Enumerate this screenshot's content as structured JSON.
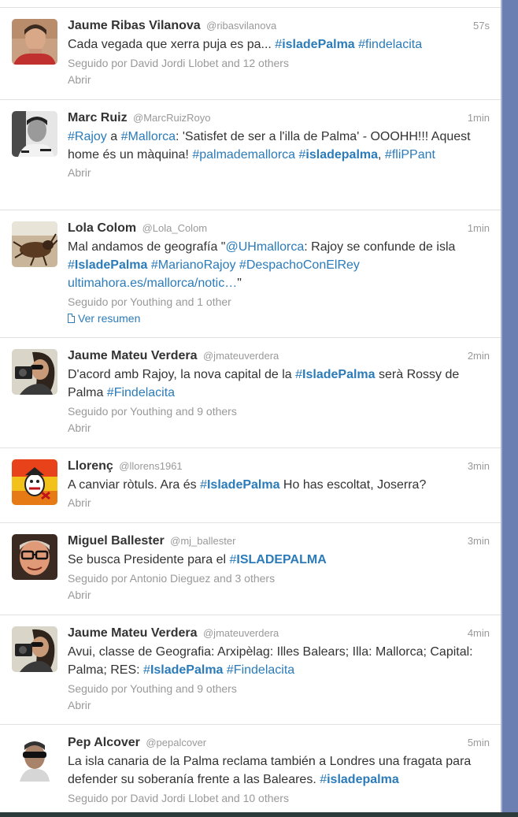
{
  "colors": {
    "link": "#2b7bb9",
    "muted": "#999999",
    "text": "#333333",
    "edge": "#6b7fb3"
  },
  "tweets": [
    {
      "name": "Jaume Ribas Vilanova",
      "handle": "@ribasvilanova",
      "time": "57s",
      "parts": [
        {
          "t": "Cada vegada que xerra puja es pa... "
        },
        {
          "t": "#",
          "c": "tag"
        },
        {
          "t": "isladePalma",
          "c": "tag-b"
        },
        {
          "t": " "
        },
        {
          "t": "#findelacita",
          "c": "tag"
        }
      ],
      "context": "Seguido por David Jordi Llobet and 12 others",
      "action": "Abrir",
      "avatar": "man-red-shirt"
    },
    {
      "name": "Marc Ruiz",
      "handle": "@MarcRuizRoyo",
      "time": "1min",
      "parts": [
        {
          "t": "#Rajoy",
          "c": "tag"
        },
        {
          "t": " a "
        },
        {
          "t": "#Mallorca",
          "c": "tag"
        },
        {
          "t": ": 'Satisfet de ser a l'illa de Palma' - OOOHH!!! Aquest home és un màquina!  "
        },
        {
          "t": "#palmademallorca",
          "c": "tag"
        },
        {
          "t": " "
        },
        {
          "t": "#",
          "c": "tag"
        },
        {
          "t": "isladepalma",
          "c": "tag-b"
        },
        {
          "t": ", "
        },
        {
          "t": "#fliPPant",
          "c": "tag"
        }
      ],
      "context": "",
      "action": "Abrir",
      "avatar": "man-bw"
    },
    {
      "name": "Lola Colom",
      "handle": "@Lola_Colom",
      "time": "1min",
      "parts": [
        {
          "t": "Mal andamos de geografía \""
        },
        {
          "t": "@UHmallorca",
          "c": "tag"
        },
        {
          "t": ": Rajoy se confunde de isla "
        },
        {
          "t": "#",
          "c": "tag"
        },
        {
          "t": "IsladePalma",
          "c": "tag-b"
        },
        {
          "t": " "
        },
        {
          "t": "#MarianoRajoy",
          "c": "tag"
        },
        {
          "t": " "
        },
        {
          "t": "#DespachoConElRey",
          "c": "tag"
        },
        {
          "t": " "
        },
        {
          "t": "ultimahora.es/mallorca/notic…",
          "c": "link"
        },
        {
          "t": "\""
        }
      ],
      "context": "Seguido por Youthing and 1 other",
      "action": "Ver resumen",
      "action_icon": "document-icon",
      "avatar": "beetle"
    },
    {
      "name": "Jaume Mateu Verdera",
      "handle": "@jmateuverdera",
      "time": "2min",
      "parts": [
        {
          "t": "D'acord amb Rajoy, la nova capital de la "
        },
        {
          "t": "#",
          "c": "tag"
        },
        {
          "t": "IsladePalma",
          "c": "tag-b"
        },
        {
          "t": " serà Rossy de Palma "
        },
        {
          "t": "#Findelacita",
          "c": "tag"
        }
      ],
      "context": "Seguido por Youthing and 9 others",
      "action": "Abrir",
      "avatar": "camera-person"
    },
    {
      "name": "Llorenç",
      "handle": "@llorens1961",
      "time": "3min",
      "parts": [
        {
          "t": "A canviar ròtuls. Ara és "
        },
        {
          "t": "#",
          "c": "tag"
        },
        {
          "t": "IsladePalma",
          "c": "tag-b"
        },
        {
          "t": " Ho has escoltat, Joserra?"
        }
      ],
      "context": "",
      "action": "Abrir",
      "avatar": "cartoon"
    },
    {
      "name": "Miguel Ballester",
      "handle": "@mj_ballester",
      "time": "3min",
      "parts": [
        {
          "t": "Se busca Presidente para el "
        },
        {
          "t": "#",
          "c": "tag"
        },
        {
          "t": "ISLADEPALMA",
          "c": "tag-b"
        }
      ],
      "context": "Seguido por Antonio Dieguez and 3 others",
      "action": "Abrir",
      "avatar": "man-glasses"
    },
    {
      "name": "Jaume Mateu Verdera",
      "handle": "@jmateuverdera",
      "time": "4min",
      "parts": [
        {
          "t": "Avui, classe de Geografia: Arxipèlag: Illes Balears; Illa: Mallorca; Capital: Palma; RES: "
        },
        {
          "t": "#",
          "c": "tag"
        },
        {
          "t": "IsladePalma",
          "c": "tag-b"
        },
        {
          "t": " "
        },
        {
          "t": "#Findelacita",
          "c": "tag"
        }
      ],
      "context": "Seguido por Youthing and 9 others",
      "action": "Abrir",
      "avatar": "camera-person"
    },
    {
      "name": "Pep Alcover",
      "handle": "@pepalcover",
      "time": "5min",
      "parts": [
        {
          "t": "La isla canaria de la Palma reclama también a Londres una fragata para defender su soberanía frente a las Baleares. "
        },
        {
          "t": "#",
          "c": "tag"
        },
        {
          "t": "isladepalma",
          "c": "tag-b"
        }
      ],
      "context": "Seguido por David Jordi Llobet and 10 others",
      "action": "",
      "avatar": "man-sunglasses"
    }
  ]
}
